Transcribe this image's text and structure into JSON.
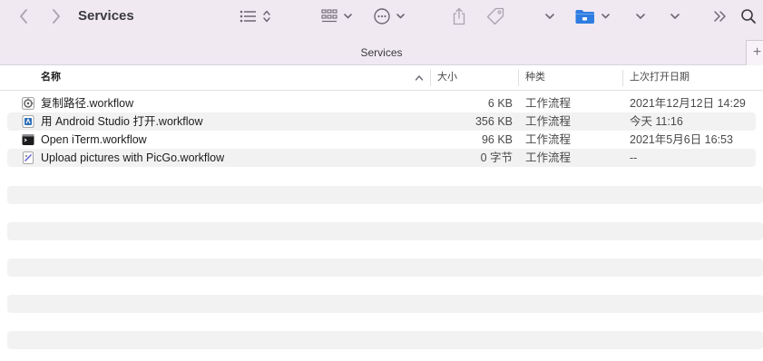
{
  "window": {
    "title": "Services"
  },
  "toolbar": {
    "back_icon": "chevron-left-icon",
    "forward_icon": "chevron-right-icon",
    "view_icon": "list-view-icon",
    "group_icon": "grid-group-icon",
    "action_icon": "ellipsis-circle-icon",
    "share_icon": "share-icon",
    "tag_icon": "tag-icon",
    "folder_icon": "folder-icon",
    "more_icon": "double-chevron-right-icon",
    "search_icon": "magnifier-icon",
    "accent_color": "#2f7de1"
  },
  "pathbar": {
    "title": "Services",
    "plus": "+"
  },
  "columns": {
    "name": "名称",
    "size": "大小",
    "kind": "种类",
    "date": "上次打开日期"
  },
  "files": [
    {
      "name": "复制路径.workflow",
      "size": "6 KB",
      "kind": "工作流程",
      "date": "2021年12月12日 14:29",
      "icon": "workflow-gear-icon"
    },
    {
      "name": "用 Android Studio 打开.workflow",
      "size": "356 KB",
      "kind": "工作流程",
      "date": "今天 11:16",
      "icon": "android-studio-workflow-icon"
    },
    {
      "name": "Open iTerm.workflow",
      "size": "96 KB",
      "kind": "工作流程",
      "date": "2021年5月6日 16:53",
      "icon": "terminal-workflow-icon"
    },
    {
      "name": "Upload pictures with PicGo.workflow",
      "size": "0 字节",
      "kind": "工作流程",
      "date": "--",
      "icon": "picgo-workflow-icon"
    }
  ]
}
